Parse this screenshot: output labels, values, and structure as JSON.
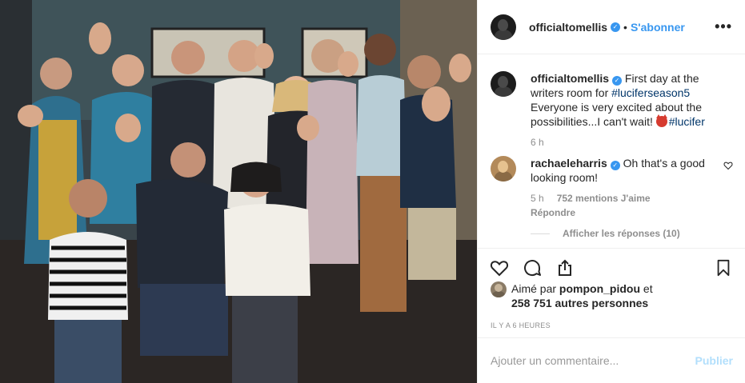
{
  "header": {
    "username": "officialtomellis",
    "separator": "•",
    "follow_label": "S'abonner",
    "more_label": "•••"
  },
  "caption": {
    "username": "officialtomellis",
    "text_before": "First day at the writers room for ",
    "hashtag1": "#luciferseason5",
    "text_after": " Everyone is very excited about the possibilities...I can't wait! ",
    "hashtag2": "#lucifer",
    "age": "6 h"
  },
  "comment": {
    "username": "rachaeleharris",
    "text": "Oh that's a good looking room!",
    "age": "5 h",
    "likes": "752 mentions J'aime",
    "reply": "Répondre",
    "show_replies": "Afficher les réponses (10)"
  },
  "likes": {
    "prefix": "Aimé par ",
    "user": "pompon_pidou",
    "middle": " et",
    "count": "258 751 autres personnes"
  },
  "timestamp": "IL Y A 6 HEURES",
  "composer": {
    "placeholder": "Ajouter un commentaire...",
    "publish_label": "Publier"
  },
  "colors": {
    "accent": "#3897f0",
    "publish_disabled": "#b2dffc",
    "hashtag": "#003569",
    "meta": "#8e8e8e"
  },
  "icons": [
    "verified-badge-icon",
    "heart-icon",
    "comment-icon",
    "share-icon",
    "bookmark-icon",
    "small-heart-icon",
    "devil-emoji-icon"
  ]
}
